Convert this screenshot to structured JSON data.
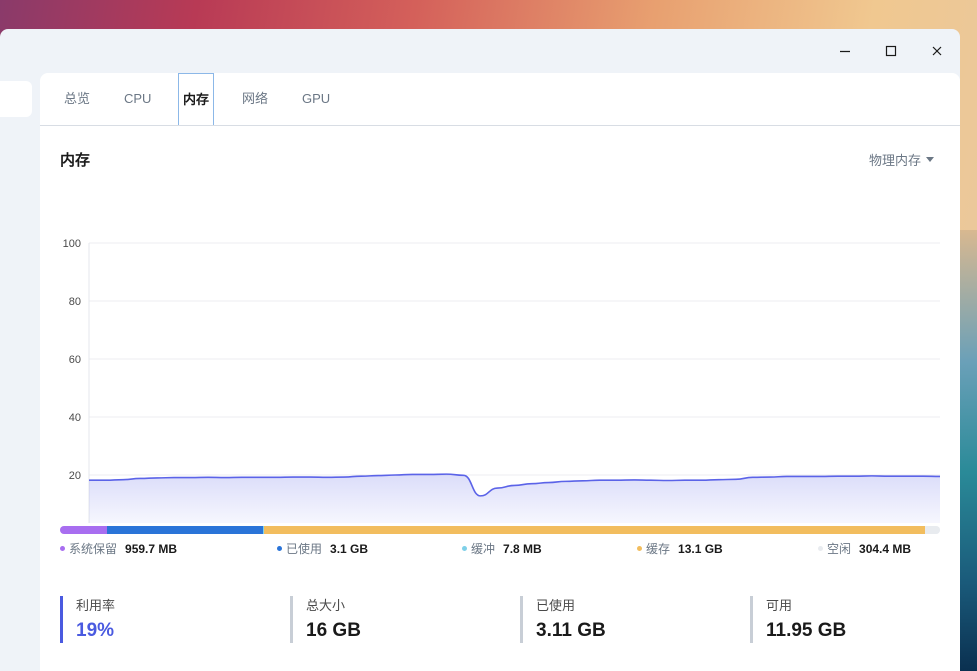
{
  "window": {
    "controls": {
      "minimize": "minimize-icon",
      "maximize": "maximize-icon",
      "close": "close-icon"
    }
  },
  "tabs": [
    {
      "label": "总览",
      "active": false
    },
    {
      "label": "CPU",
      "active": false
    },
    {
      "label": "内存",
      "active": true
    },
    {
      "label": "网络",
      "active": false
    },
    {
      "label": "GPU",
      "active": false
    }
  ],
  "section": {
    "title": "内存",
    "dropdown": "物理内存"
  },
  "chart_data": {
    "type": "area",
    "title": "",
    "xlabel": "",
    "ylabel": "",
    "ylim": [
      0,
      100
    ],
    "yticks": [
      "100",
      "80",
      "60",
      "40",
      "20"
    ],
    "grid": true,
    "series": [
      {
        "color": "#5b63e8",
        "values": [
          18.2,
          18.2,
          18.4,
          18.8,
          19.0,
          19.1,
          19.1,
          19.2,
          19.1,
          19.2,
          19.2,
          19.2,
          19.3,
          19.3,
          19.2,
          19.3,
          19.6,
          19.8,
          20.0,
          20.2,
          20.2,
          20.3,
          19.9,
          12.8,
          15.5,
          16.4,
          17.0,
          17.4,
          17.8,
          18.0,
          18.2,
          18.2,
          18.3,
          18.2,
          18.1,
          18.2,
          18.2,
          18.4,
          18.5,
          19.2,
          19.3,
          19.5,
          19.5,
          19.5,
          19.6,
          19.6,
          19.7,
          19.6,
          19.6,
          19.6,
          19.5
        ]
      }
    ]
  },
  "memory_bar": {
    "segments": [
      {
        "name": "系统保留",
        "value": "959.7 MB",
        "color": "#a86ef0",
        "fraction": 0.0536
      },
      {
        "name": "已使用",
        "value": "3.1 GB",
        "color": "#2a74d8",
        "fraction": 0.1773
      },
      {
        "name": "缓冲",
        "value": "7.8 MB",
        "color": "#7fd0e8",
        "fraction": 0.0005
      },
      {
        "name": "缓存",
        "value": "13.1 GB",
        "color": "#f2bd5e",
        "fraction": 0.7519
      },
      {
        "name": "空闲",
        "value": "304.4 MB",
        "color": "#e8ebef",
        "fraction": 0.0167
      }
    ]
  },
  "stats": [
    {
      "label": "利用率",
      "value": "19%"
    },
    {
      "label": "总大小",
      "value": "16 GB"
    },
    {
      "label": "已使用",
      "value": "3.11 GB"
    },
    {
      "label": "可用",
      "value": "11.95 GB"
    }
  ]
}
